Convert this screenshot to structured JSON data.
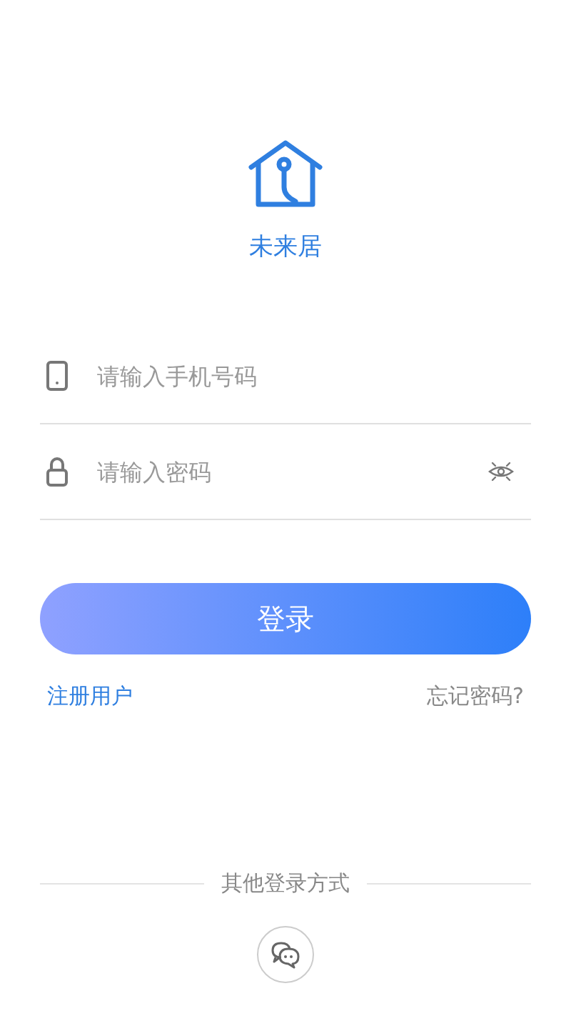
{
  "app_name": "未来居",
  "phone_field": {
    "placeholder": "请输入手机号码"
  },
  "password_field": {
    "placeholder": "请输入密码",
    "visible": false
  },
  "login_button": "登录",
  "register_link": "注册用户",
  "forgot_link": "忘记密码?",
  "other_login": {
    "label": "其他登录方式"
  }
}
